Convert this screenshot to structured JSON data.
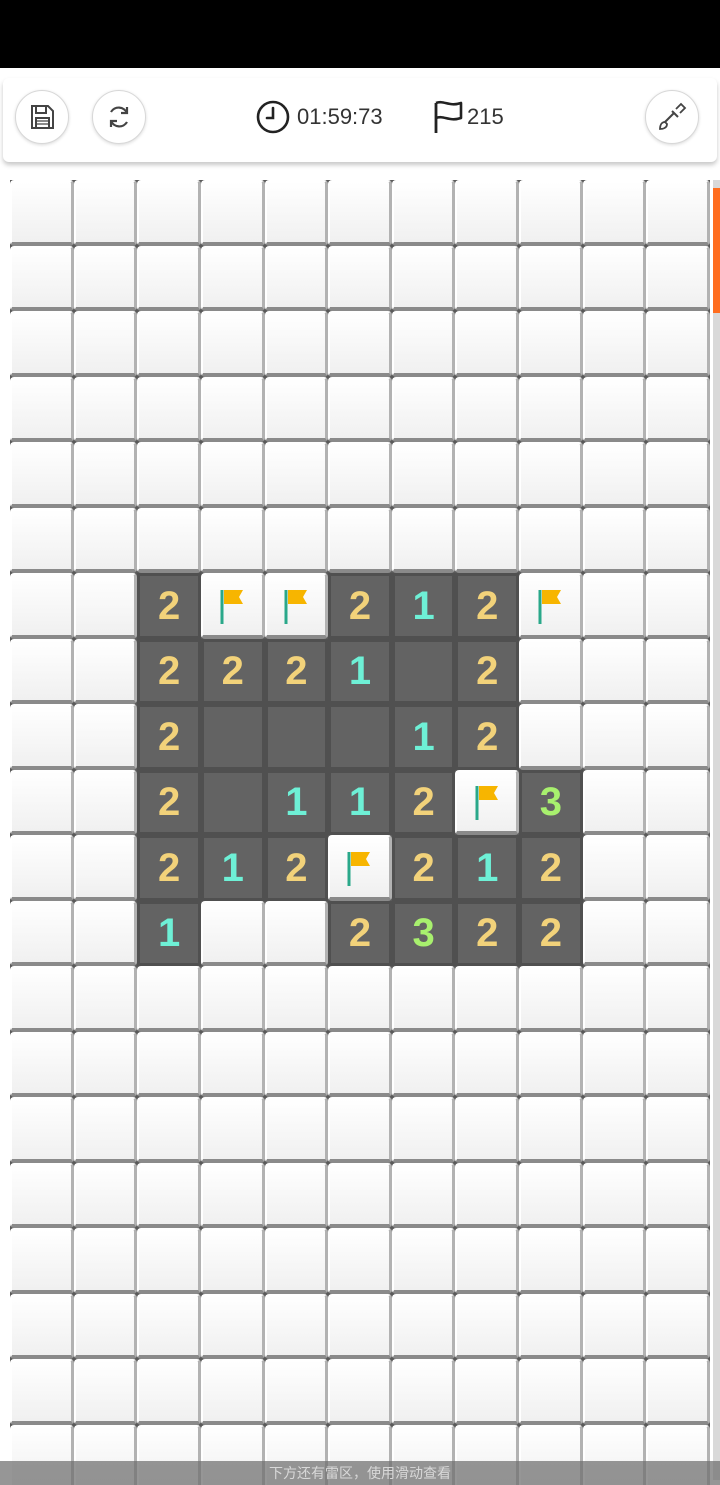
{
  "toolbar": {
    "timer": "01:59:73",
    "flags_remaining": "215"
  },
  "board": {
    "columns": 11,
    "rows": [
      [
        "H",
        "H",
        "H",
        "H",
        "H",
        "H",
        "H",
        "H",
        "H",
        "H",
        "H"
      ],
      [
        "H",
        "H",
        "H",
        "H",
        "H",
        "H",
        "H",
        "H",
        "H",
        "H",
        "H"
      ],
      [
        "H",
        "H",
        "H",
        "H",
        "H",
        "H",
        "H",
        "H",
        "H",
        "H",
        "H"
      ],
      [
        "H",
        "H",
        "H",
        "H",
        "H",
        "H",
        "H",
        "H",
        "H",
        "H",
        "H"
      ],
      [
        "H",
        "H",
        "H",
        "H",
        "H",
        "H",
        "H",
        "H",
        "H",
        "H",
        "H"
      ],
      [
        "H",
        "H",
        "H",
        "H",
        "H",
        "H",
        "H",
        "H",
        "H",
        "H",
        "H"
      ],
      [
        "H",
        "H",
        "2",
        "F",
        "F",
        "2",
        "1",
        "2",
        "F",
        "H",
        "H"
      ],
      [
        "H",
        "H",
        "2",
        "2",
        "2",
        "1",
        "0",
        "2",
        "H",
        "H",
        "H"
      ],
      [
        "H",
        "H",
        "2",
        "0",
        "0",
        "0",
        "1",
        "2",
        "H",
        "H",
        "H"
      ],
      [
        "H",
        "H",
        "2",
        "0",
        "1",
        "1",
        "2",
        "F",
        "3",
        "H",
        "H"
      ],
      [
        "H",
        "H",
        "2",
        "1",
        "2",
        "F",
        "2",
        "1",
        "2",
        "H",
        "H"
      ],
      [
        "H",
        "H",
        "1",
        "H",
        "H",
        "2",
        "3",
        "2",
        "2",
        "H",
        "H"
      ],
      [
        "H",
        "H",
        "H",
        "H",
        "H",
        "H",
        "H",
        "H",
        "H",
        "H",
        "H"
      ],
      [
        "H",
        "H",
        "H",
        "H",
        "H",
        "H",
        "H",
        "H",
        "H",
        "H",
        "H"
      ],
      [
        "H",
        "H",
        "H",
        "H",
        "H",
        "H",
        "H",
        "H",
        "H",
        "H",
        "H"
      ],
      [
        "H",
        "H",
        "H",
        "H",
        "H",
        "H",
        "H",
        "H",
        "H",
        "H",
        "H"
      ],
      [
        "H",
        "H",
        "H",
        "H",
        "H",
        "H",
        "H",
        "H",
        "H",
        "H",
        "H"
      ],
      [
        "H",
        "H",
        "H",
        "H",
        "H",
        "H",
        "H",
        "H",
        "H",
        "H",
        "H"
      ],
      [
        "H",
        "H",
        "H",
        "H",
        "H",
        "H",
        "H",
        "H",
        "H",
        "H",
        "H"
      ],
      [
        "H",
        "H",
        "H",
        "H",
        "H",
        "H",
        "H",
        "H",
        "H",
        "H",
        "H"
      ]
    ],
    "legend": {
      "H": "hidden",
      "F": "flag",
      "0": "empty-open"
    }
  },
  "hint": "下方还有雷区，使用滑动查看",
  "colors": {
    "number_1": "#6ef0d6",
    "number_2": "#f2d27a",
    "number_3": "#a8f06e",
    "flag": "#f7b500",
    "scroll_thumb": "#ff6d1f"
  }
}
